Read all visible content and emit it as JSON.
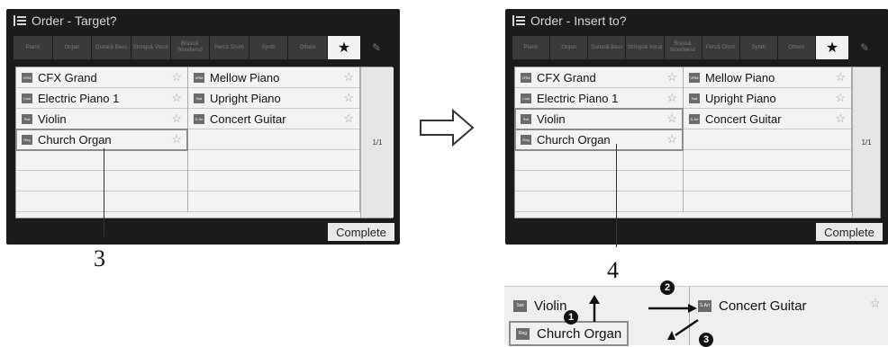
{
  "left": {
    "title": "Order - Target?",
    "tabs": [
      "Piano",
      "Organ",
      "Guitar& Bass",
      "Strings& Vocal",
      "Brass& Woodwind",
      "Perc& Drum",
      "Synth",
      "Others"
    ],
    "fav_icon": "★",
    "col1": [
      "CFX Grand",
      "Electric Piano 1",
      "Violin",
      "Church Organ"
    ],
    "col2": [
      "Mellow Piano",
      "Upright Piano",
      "Concert Guitar"
    ],
    "page": "1/1",
    "complete": "Complete",
    "callout": "3"
  },
  "right": {
    "title": "Order - Insert to?",
    "tabs": [
      "Piano",
      "Organ",
      "Guitar& Bass",
      "Strings& Vocal",
      "Brass& Woodwind",
      "Perc& Drum",
      "Synth",
      "Others"
    ],
    "fav_icon": "★",
    "col1": [
      "CFX Grand",
      "Electric Piano 1",
      "Violin",
      "Church Organ"
    ],
    "col2": [
      "Mellow Piano",
      "Upright Piano",
      "Concert Guitar"
    ],
    "page": "1/1",
    "complete": "Complete",
    "callout": "4"
  },
  "zoom": {
    "left_top": "Violin",
    "left_bottom": "Church Organ",
    "right_top": "Concert Guitar",
    "steps": [
      "1",
      "2",
      "3"
    ]
  },
  "icons": {
    "arrow": "right-arrow-icon",
    "star": "star-icon",
    "edit": "edit-pencil-icon"
  }
}
